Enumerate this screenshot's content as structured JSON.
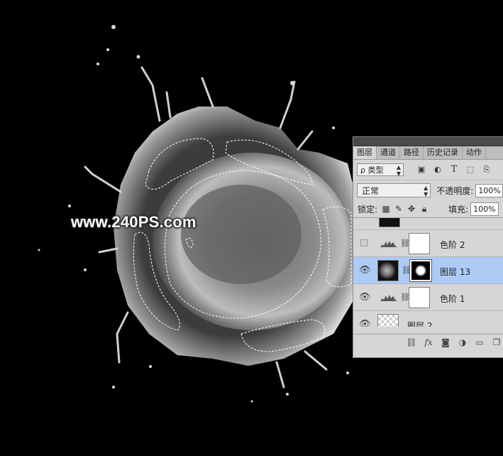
{
  "watermark": "www.240PS.com",
  "panel": {
    "tabs": [
      {
        "label": "图层",
        "active": true
      },
      {
        "label": "通道",
        "active": false
      },
      {
        "label": "路径",
        "active": false
      },
      {
        "label": "历史记录",
        "active": false
      },
      {
        "label": "动作",
        "active": false
      }
    ],
    "filter": {
      "search_glyph": "ρ",
      "value": "类型",
      "icons": [
        "image-filter-icon",
        "adjustment-filter-icon",
        "type-filter-icon",
        "shape-filter-icon",
        "smart-object-filter-icon"
      ]
    },
    "blend": {
      "mode": "正常",
      "opacity_label": "不透明度:",
      "opacity_value": "100%"
    },
    "lock": {
      "label": "锁定:",
      "fill_label": "填充:",
      "fill_value": "100%"
    },
    "layers": [
      {
        "name": "色阶 2",
        "visible": false,
        "type": "adjustment",
        "selected": false
      },
      {
        "name": "图层 13",
        "visible": true,
        "type": "masked",
        "selected": true
      },
      {
        "name": "色阶 1",
        "visible": true,
        "type": "adjustment",
        "selected": false
      },
      {
        "name": "图层 2",
        "visible": true,
        "type": "transparent",
        "selected": false
      }
    ],
    "bottom_icons": [
      "link-layers-icon",
      "fx-icon",
      "add-mask-icon",
      "new-fill-adjustment-icon",
      "new-group-icon",
      "new-layer-icon"
    ],
    "colors": {
      "selected_row": "#aecbf6",
      "panel_bg": "#d6d6d6"
    }
  }
}
